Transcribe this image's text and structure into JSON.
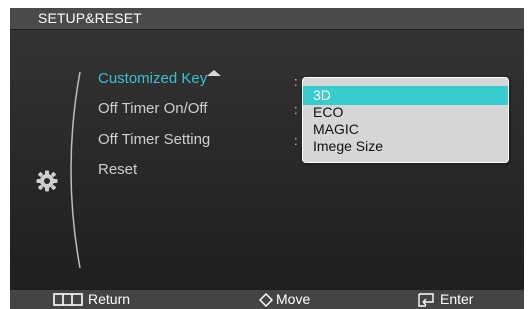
{
  "title": "SETUP&RESET",
  "menu": {
    "items": [
      {
        "label": "Customized Key",
        "selected": true
      },
      {
        "label": "Off Timer On/Off",
        "selected": false
      },
      {
        "label": "Off Timer Setting",
        "selected": false
      },
      {
        "label": "Reset",
        "selected": false
      }
    ],
    "colon": ":"
  },
  "dropdown": {
    "options": [
      {
        "label": "3D",
        "selected": true
      },
      {
        "label": "ECO",
        "selected": false
      },
      {
        "label": "MAGIC",
        "selected": false
      },
      {
        "label": "Imege Size",
        "selected": false
      }
    ]
  },
  "footer": {
    "return_label": "Return",
    "move_label": "Move",
    "enter_label": "Enter"
  },
  "icons": {
    "category": "gear-icon",
    "scroll": "triangle-up-icon",
    "return": "menu-bars-icon",
    "move": "diamond-arrows-icon",
    "enter": "enter-icon"
  },
  "colors": {
    "accent": "#38c2d2",
    "highlight": "#39cccd"
  }
}
